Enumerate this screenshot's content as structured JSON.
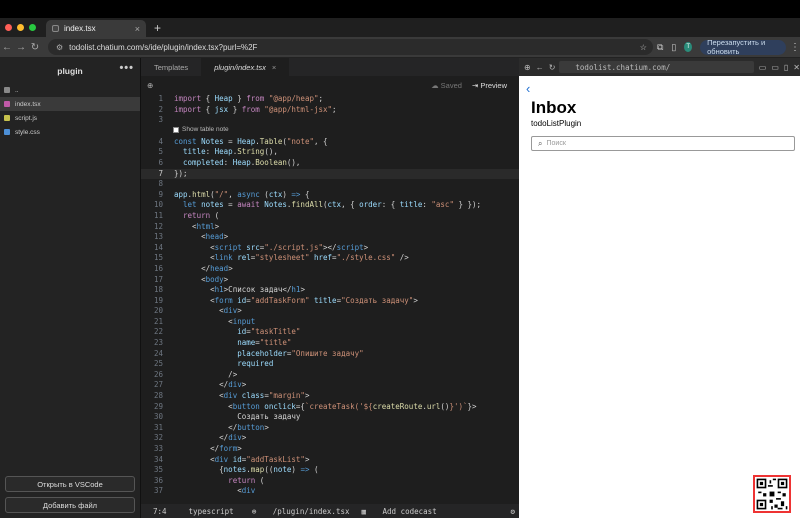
{
  "browser": {
    "tab_title": "index.tsx",
    "url": "todolist.chatium.com/s/ide/plugin/index.tsx?purl=%2F",
    "avatar_letter": "T",
    "relaunch_label": "Перезапустить и обновить"
  },
  "sidebar": {
    "title": "plugin",
    "files": [
      {
        "name": "..",
        "color": "#888888"
      },
      {
        "name": "index.tsx",
        "color": "#c05aa8"
      },
      {
        "name": "script.js",
        "color": "#c7c24c"
      },
      {
        "name": "style.css",
        "color": "#4c8fd6"
      }
    ],
    "open_vscode_label": "Открыть в VSCode",
    "add_file_label": "Добавить файл"
  },
  "editor": {
    "tabs": [
      "Templates",
      "plugin/index.tsx"
    ],
    "saved_label": "Saved",
    "preview_label": "Preview",
    "show_table_note": "Show table note",
    "status": {
      "position": "7:4",
      "language": "typescript",
      "path": "/plugin/index.tsx",
      "add_codecast": "Add codecast"
    },
    "lines": [
      "1",
      "2",
      "3",
      "4",
      "5",
      "6",
      "7",
      "8",
      "9",
      "10",
      "11",
      "12",
      "13",
      "14",
      "15",
      "16",
      "17",
      "18",
      "19",
      "20",
      "21",
      "22",
      "23",
      "24",
      "25",
      "26",
      "27",
      "28",
      "29",
      "30",
      "31",
      "32",
      "33",
      "34",
      "35",
      "36",
      "37"
    ]
  },
  "preview": {
    "url": "todolist.chatium.com/",
    "title": "Inbox",
    "subtitle": "todoListPlugin",
    "search_placeholder": "Поиск"
  },
  "colors": {
    "accent": "#1f6fd1",
    "background": "#1e1e1e"
  }
}
